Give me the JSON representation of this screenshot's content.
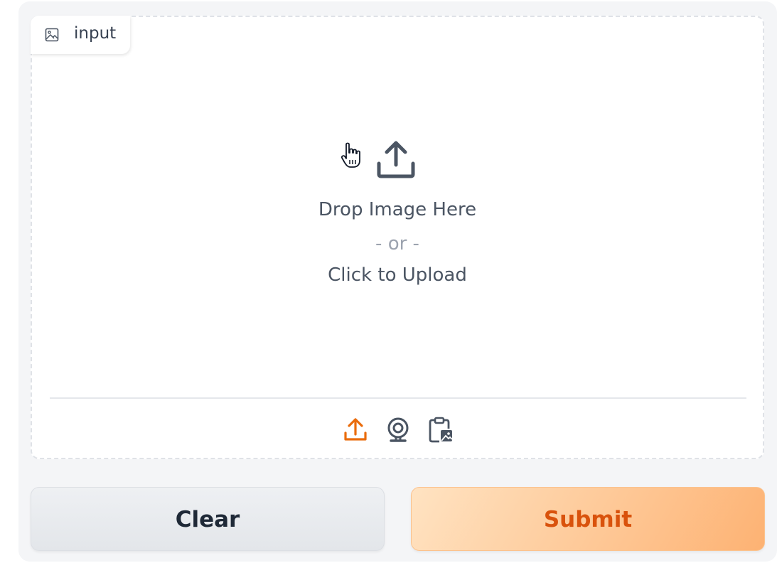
{
  "input_block": {
    "label": "input",
    "label_icon": "image-icon",
    "dropzone": {
      "line1": "Drop Image Here",
      "line2": "- or -",
      "line3": "Click to Upload",
      "icon": "upload-icon"
    },
    "sources": [
      {
        "name": "upload",
        "icon": "upload-icon",
        "active": true
      },
      {
        "name": "webcam",
        "icon": "webcam-icon",
        "active": false
      },
      {
        "name": "clipboard",
        "icon": "clipboard-image-icon",
        "active": false
      }
    ]
  },
  "actions": {
    "clear_label": "Clear",
    "submit_label": "Submit"
  },
  "colors": {
    "accent": "#ea6c0c",
    "text": "#4b5563",
    "submit_text": "#d9520c"
  }
}
